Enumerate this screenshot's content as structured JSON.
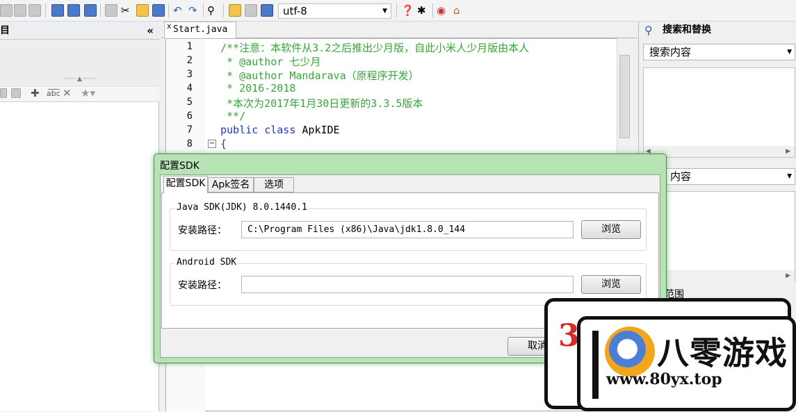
{
  "toolbar": {
    "encoding": "utf-8",
    "icons": [
      "new-icon",
      "open-icon",
      "save-icon",
      "save-all-icon",
      "export-icon",
      "copy-icon",
      "cut-icon",
      "paste-icon",
      "replace-icon",
      "undo-icon",
      "redo-icon",
      "find-icon",
      "jar-icon",
      "android-icon",
      "build-icon",
      "help-icon",
      "bug-icon",
      "weibo-icon",
      "home-icon"
    ]
  },
  "left_panel": {
    "title": "目",
    "collapse_glyph": "«"
  },
  "editor": {
    "tab_label": "Start.java",
    "tab_close": "x",
    "lines": [
      {
        "n": "1",
        "text": "/**注意：本软件从3.2之后推出少月版，自此小米人少月版由本人"
      },
      {
        "n": "2",
        "text": " * @author 七少月"
      },
      {
        "n": "3",
        "text": " * @author Mandarava（原程序开发）"
      },
      {
        "n": "4",
        "text": " * 2016-2018"
      },
      {
        "n": "5",
        "text": " *本次为2017年1月30日更新的3.3.5版本"
      },
      {
        "n": "6",
        "text": " **/"
      },
      {
        "n": "7",
        "kw1": "public",
        "kw2": "class",
        "name": " ApkIDE"
      },
      {
        "n": "8",
        "text": "{"
      }
    ]
  },
  "right_panel": {
    "title": "搜索和替换",
    "search_placeholder": "搜索内容",
    "replace_partial": "内容",
    "scope_partial": "范围"
  },
  "dialog": {
    "title": "配置SDK",
    "tabs": [
      "配置SDK",
      "Apk签名",
      "选项"
    ],
    "java_group": "Java SDK(JDK) 8.0.1440.1",
    "android_group": "Android SDK",
    "install_label": "安装路径：",
    "java_path": "C:\\Program Files (x86)\\Java\\jdk1.8.0_144",
    "android_path": "",
    "browse_label": "浏览",
    "cancel_label": "取消"
  },
  "watermark": {
    "name": "八零游戏",
    "url": "www.80yx.top",
    "digit": "3"
  }
}
